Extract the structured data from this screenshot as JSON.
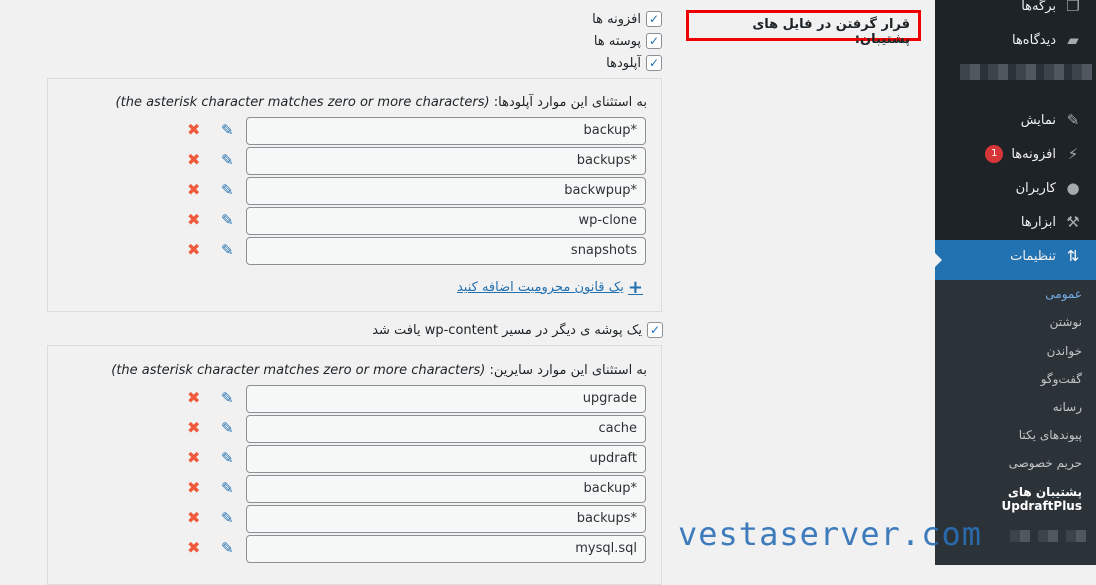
{
  "sidebar": {
    "items": [
      {
        "label": "برگه‌ها",
        "icon": "pages-icon"
      },
      {
        "label": "دیدگاه‌ها",
        "icon": "comments-icon"
      },
      {
        "label": "نمایش",
        "icon": "appearance-icon"
      },
      {
        "label": "افزونه‌ها",
        "icon": "plugins-icon",
        "badge": "1"
      },
      {
        "label": "کاربران",
        "icon": "users-icon"
      },
      {
        "label": "ابزارها",
        "icon": "tools-icon"
      },
      {
        "label": "تنظیمات",
        "icon": "settings-icon",
        "active": true
      }
    ],
    "submenu": [
      "عمومی",
      "نوشتن",
      "خواندن",
      "گفت‌وگو",
      "رسانه",
      "پیوندهای یکتا",
      "حریم خصوصی"
    ],
    "submenu_bold_line1": "پشتیبان های",
    "submenu_bold_line2": "UpdraftPlus"
  },
  "heading": "قرار گرفتن در فایل های پشتیبان:",
  "checkboxes": [
    "افزونه ها",
    "پوسته ها",
    "آپلودها"
  ],
  "uploads_panel": {
    "note": "به استثنای این موارد آپلودها: ",
    "note_en": "(the asterisk character matches zero or more characters)",
    "rules": [
      "backup*",
      "backups*",
      "backwpup*",
      "wp-clone",
      "snapshots"
    ],
    "add_link": "یک قانون محرومیت اضافه کنید"
  },
  "other_checkbox": "یک پوشه ی دیگر در مسیر wp-content یافت شد",
  "others_panel": {
    "note": "به استثنای این موارد سایرین: ",
    "note_en": "(the asterisk character matches zero or more characters)",
    "rules": [
      "upgrade",
      "cache",
      "updraft",
      "backup*",
      "backups*",
      "mysql.sql"
    ]
  },
  "watermark": "vestaserver.com",
  "colors": {
    "accent": "#2271b1",
    "sidebar": "#1d2327",
    "delete": "#f05a3b",
    "highlight_box": "#ee0000"
  }
}
